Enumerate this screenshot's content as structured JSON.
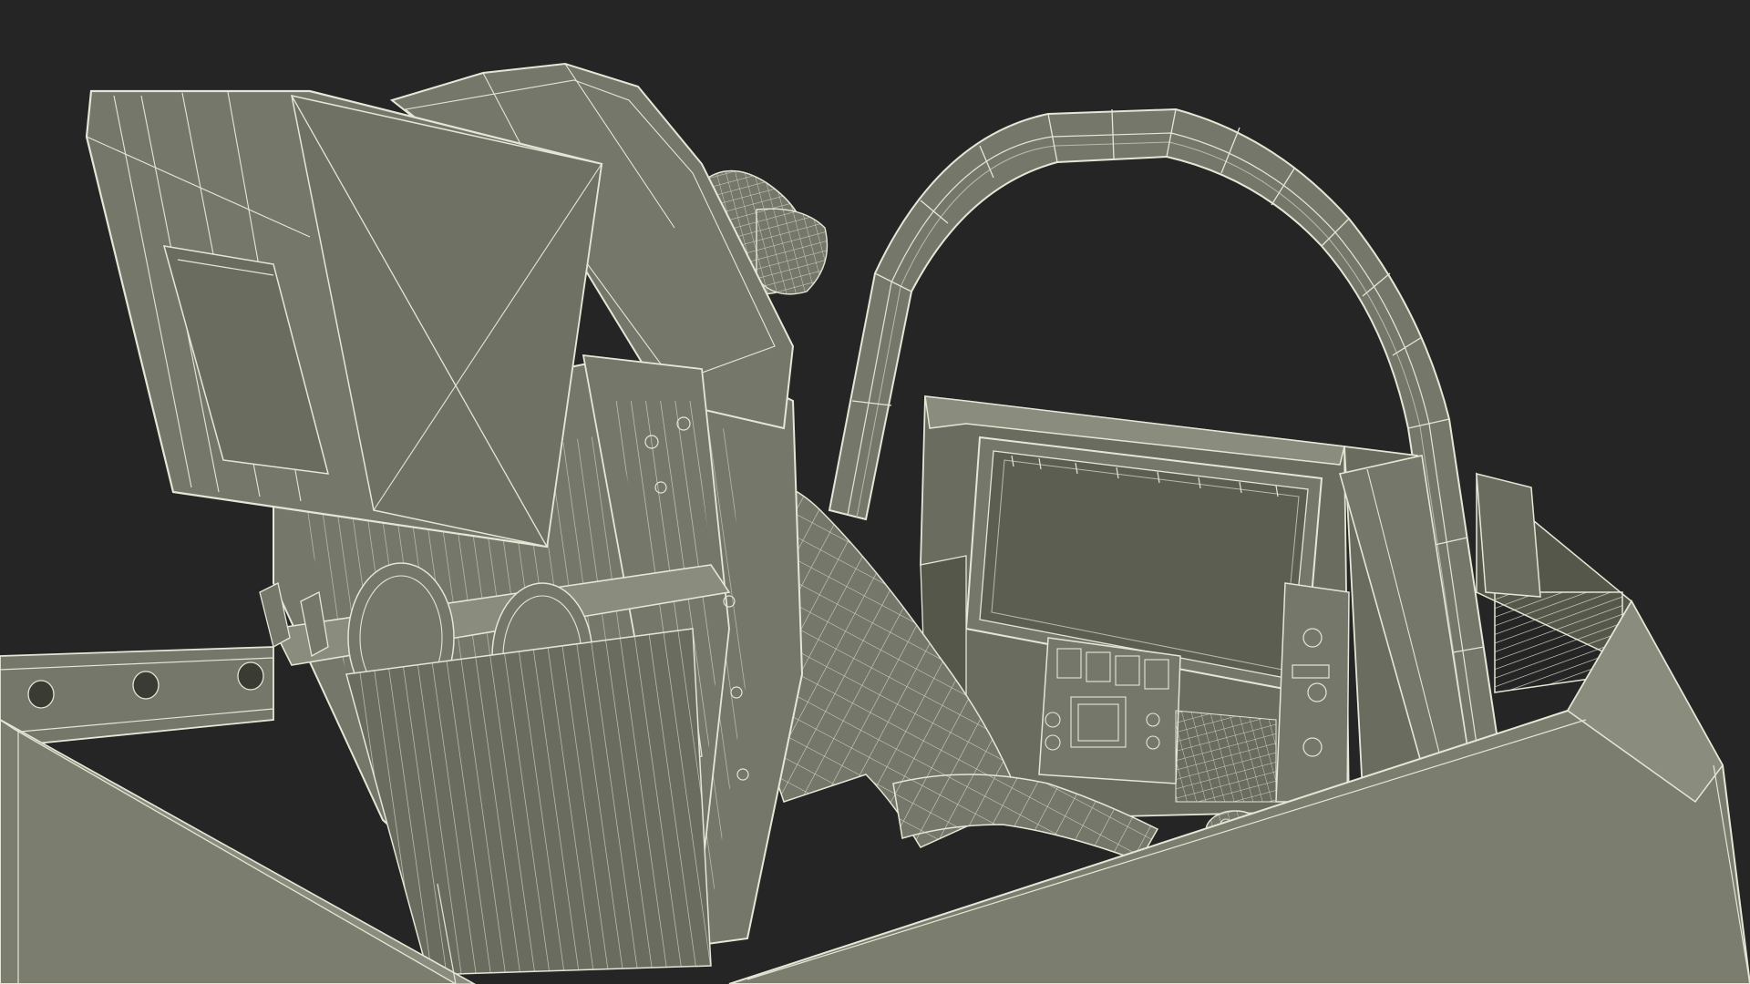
{
  "scene": {
    "subject": "cockpit-wireframe-render",
    "colors": {
      "background": "#252525",
      "surface": "#75776a",
      "surface_dark": "#55574b",
      "surface_light": "#8a8c7e",
      "wire": "#e6e6d6",
      "wire_dim": "#b9baa9",
      "screen": "#5c5e52"
    }
  }
}
